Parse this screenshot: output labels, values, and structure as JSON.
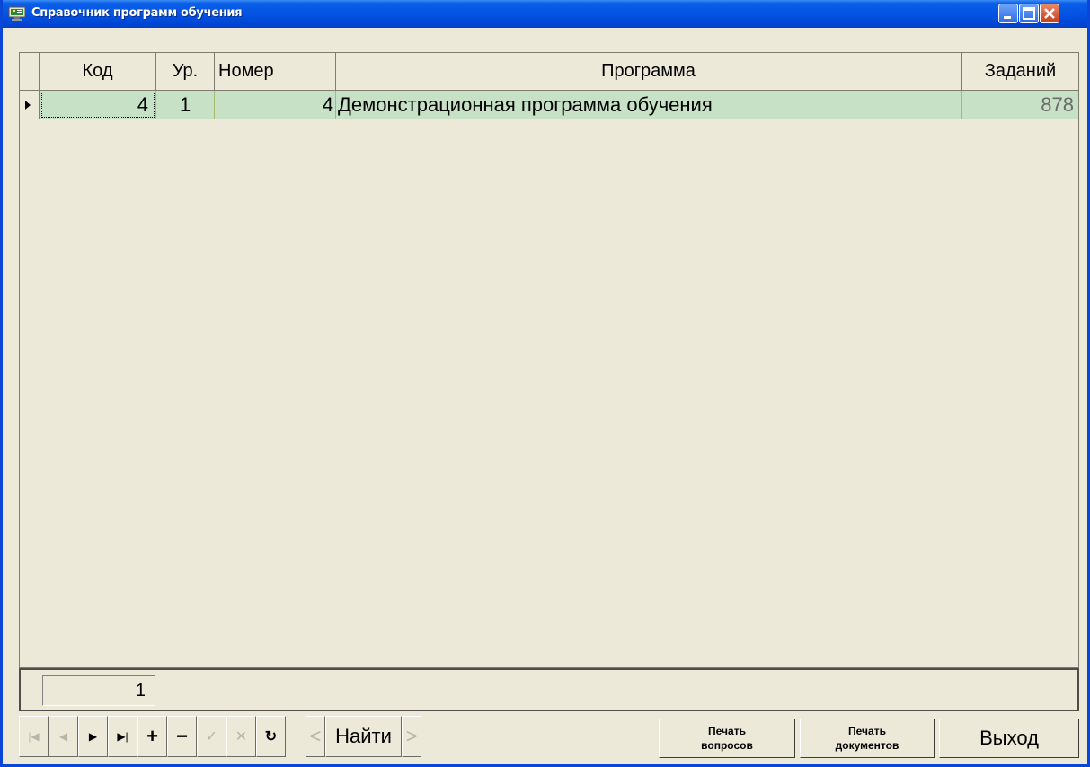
{
  "window": {
    "title": "Справочник программ обучения"
  },
  "grid": {
    "columns": [
      "Код",
      "Ур.",
      "Номер",
      "Программа",
      "Заданий"
    ],
    "rows": [
      {
        "kod": "4",
        "level": "1",
        "nomer": "4",
        "programma": "Демонстрационная программа обучения",
        "zadaniy": "878"
      }
    ]
  },
  "status": {
    "record_count": "1"
  },
  "toolbar": {
    "first": "|◀",
    "prior": "◀",
    "next": "▶",
    "last": "▶|",
    "insert": "+",
    "delete": "−",
    "post": "✓",
    "cancel": "✕",
    "refresh": "↻",
    "find_prev": "<",
    "find_label": "Найти",
    "find_next": ">"
  },
  "actions": {
    "print_questions_line1": "Печать",
    "print_questions_line2": "вопросов",
    "print_docs_line1": "Печать",
    "print_docs_line2": "документов",
    "exit": "Выход"
  },
  "colors": {
    "title_bar": "#0454e2",
    "row_selected": "#c7e1c6",
    "face": "#ece9d8"
  }
}
